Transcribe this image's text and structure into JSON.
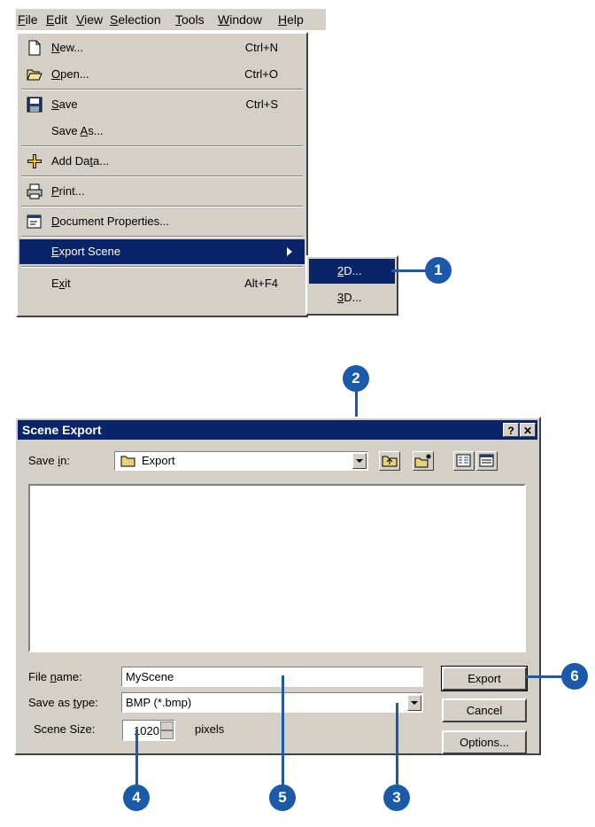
{
  "menubar": {
    "items": [
      {
        "pre": "",
        "u": "F",
        "post": "ile"
      },
      {
        "pre": "",
        "u": "E",
        "post": "dit"
      },
      {
        "pre": "",
        "u": "V",
        "post": "iew"
      },
      {
        "pre": "",
        "u": "S",
        "post": "election"
      },
      {
        "pre": "",
        "u": "T",
        "post": "ools"
      },
      {
        "pre": "",
        "u": "W",
        "post": "indow"
      },
      {
        "pre": "",
        "u": "H",
        "post": "elp"
      }
    ]
  },
  "file_menu": {
    "new": {
      "pre": "",
      "u": "N",
      "post": "ew...",
      "shortcut": "Ctrl+N",
      "icon": "new-document-icon"
    },
    "open": {
      "pre": "",
      "u": "O",
      "post": "pen...",
      "shortcut": "Ctrl+O",
      "icon": "open-folder-icon"
    },
    "save": {
      "pre": "",
      "u": "S",
      "post": "ave",
      "shortcut": "Ctrl+S",
      "icon": "floppy-disk-icon"
    },
    "save_as": {
      "pre": "Save ",
      "u": "A",
      "post": "s..."
    },
    "add_data": {
      "pre": "Add Da",
      "u": "t",
      "post": "a...",
      "icon": "add-data-icon"
    },
    "print": {
      "pre": "",
      "u": "P",
      "post": "rint...",
      "icon": "printer-icon"
    },
    "doc_props": {
      "pre": "",
      "u": "D",
      "post": "ocument Properties...",
      "icon": "document-properties-icon"
    },
    "export": {
      "pre": "",
      "u": "E",
      "post": "xport Scene"
    },
    "exit": {
      "pre": "E",
      "u": "x",
      "post": "it",
      "shortcut": "Alt+F4"
    }
  },
  "export_submenu": {
    "d2": {
      "pre": "",
      "u": "2",
      "post": "D..."
    },
    "d3": {
      "pre": "",
      "u": "3",
      "post": "D..."
    }
  },
  "callouts": [
    "1",
    "2",
    "3",
    "4",
    "5",
    "6"
  ],
  "dialog": {
    "title": "Scene Export",
    "help_button": "?",
    "close_button": "✕",
    "save_in_label": {
      "pre": "Save ",
      "u": "i",
      "post": "n:"
    },
    "save_in_value": "Export",
    "file_name_label": {
      "pre": "File ",
      "u": "n",
      "post": "ame:"
    },
    "file_name_value": "MyScene",
    "save_as_type_label": {
      "pre": "Save as ",
      "u": "t",
      "post": "ype:"
    },
    "save_as_type_value": "BMP (*.bmp)",
    "scene_size_label": "Scene Size:",
    "scene_size_value": "1020",
    "scene_size_unit": "pixels",
    "export_button": "Export",
    "cancel_button": "Cancel",
    "options_button": "Options..."
  },
  "colors": {
    "callout": "#1a5aa8",
    "selection": "#0a246a",
    "face": "#d4d0c8"
  }
}
